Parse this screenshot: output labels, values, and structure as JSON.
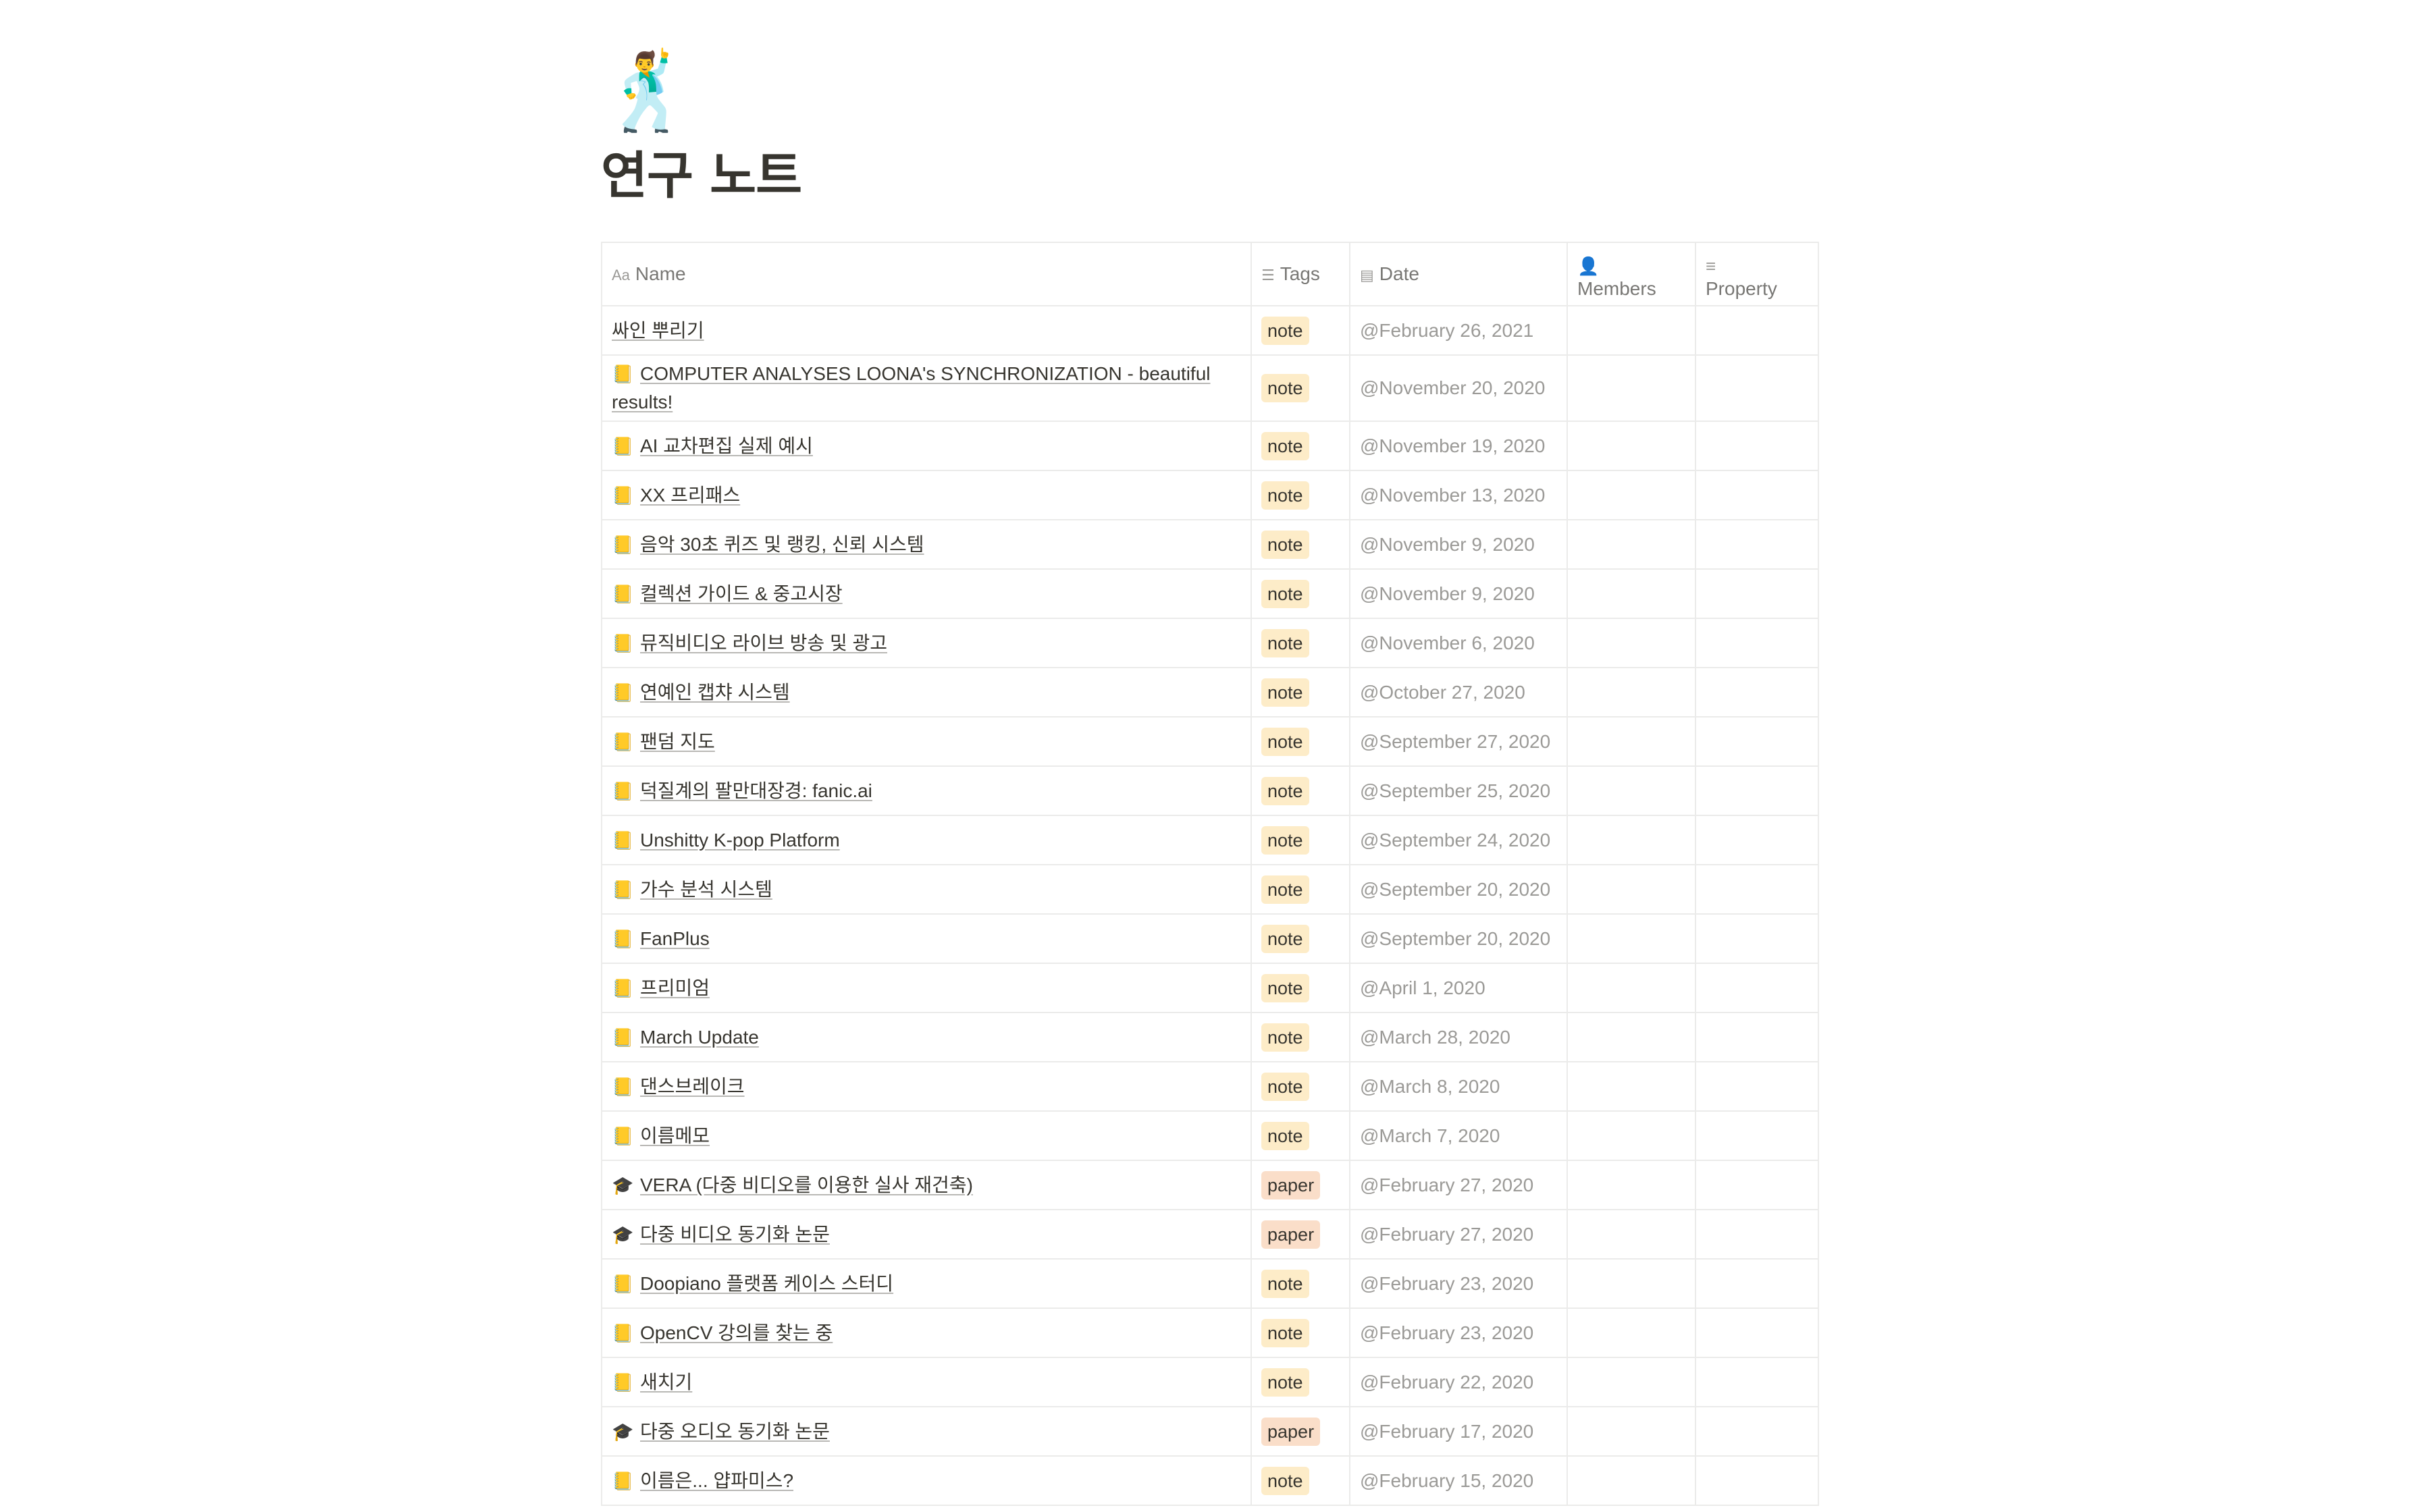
{
  "page": {
    "icon": "🕺",
    "title": "연구 노트"
  },
  "columns": {
    "name": {
      "label": "Name",
      "icon": "Aa"
    },
    "tags": {
      "label": "Tags",
      "icon": "list-icon"
    },
    "date": {
      "label": "Date",
      "icon": "calendar-icon"
    },
    "members": {
      "label": "Members",
      "icon": "person-icon"
    },
    "property": {
      "label": "Property",
      "icon": "text-lines-icon"
    }
  },
  "tag_colors": {
    "note": "#fdecc8",
    "paper": "#fadec9"
  },
  "rows": [
    {
      "icon": "",
      "name": "싸인 뿌리기",
      "tag": "note",
      "date": "@February 26, 2021"
    },
    {
      "icon": "📒",
      "name": "COMPUTER ANALYSES LOONA's SYNCHRONIZATION - beautiful results!",
      "tag": "note",
      "date": "@November 20, 2020"
    },
    {
      "icon": "📒",
      "name": "AI 교차편집 실제 예시",
      "tag": "note",
      "date": "@November 19, 2020"
    },
    {
      "icon": "📒",
      "name": "XX 프리패스",
      "tag": "note",
      "date": "@November 13, 2020"
    },
    {
      "icon": "📒",
      "name": "음악 30초 퀴즈 및 랭킹, 신뢰 시스템",
      "tag": "note",
      "date": "@November 9, 2020"
    },
    {
      "icon": "📒",
      "name": "컬렉션 가이드 & 중고시장",
      "tag": "note",
      "date": "@November 9, 2020"
    },
    {
      "icon": "📒",
      "name": "뮤직비디오 라이브 방송 및 광고",
      "tag": "note",
      "date": "@November 6, 2020"
    },
    {
      "icon": "📒",
      "name": "연예인 캡챠 시스템",
      "tag": "note",
      "date": "@October 27, 2020"
    },
    {
      "icon": "📒",
      "name": "팬덤 지도",
      "tag": "note",
      "date": "@September 27, 2020"
    },
    {
      "icon": "📒",
      "name": "덕질계의 팔만대장경: fanic.ai",
      "tag": "note",
      "date": "@September 25, 2020"
    },
    {
      "icon": "📒",
      "name": "Unshitty K-pop Platform",
      "tag": "note",
      "date": "@September 24, 2020"
    },
    {
      "icon": "📒",
      "name": "가수 분석 시스템",
      "tag": "note",
      "date": "@September 20, 2020"
    },
    {
      "icon": "📒",
      "name": "FanPlus",
      "tag": "note",
      "date": "@September 20, 2020"
    },
    {
      "icon": "📒",
      "name": "프리미엄",
      "tag": "note",
      "date": "@April 1, 2020"
    },
    {
      "icon": "📒",
      "name": "March Update",
      "tag": "note",
      "date": "@March 28, 2020"
    },
    {
      "icon": "📒",
      "name": "댄스브레이크",
      "tag": "note",
      "date": "@March 8, 2020"
    },
    {
      "icon": "📒",
      "name": "이름메모",
      "tag": "note",
      "date": "@March 7, 2020"
    },
    {
      "icon": "🎓",
      "name": "VERA (다중 비디오를 이용한 실사 재건축)",
      "tag": "paper",
      "date": "@February 27, 2020"
    },
    {
      "icon": "🎓",
      "name": "다중 비디오 동기화 논문",
      "tag": "paper",
      "date": "@February 27, 2020"
    },
    {
      "icon": "📒",
      "name": "Doopiano 플랫폼 케이스 스터디",
      "tag": "note",
      "date": "@February 23, 2020"
    },
    {
      "icon": "📒",
      "name": "OpenCV 강의를 찾는 중",
      "tag": "note",
      "date": "@February 23, 2020"
    },
    {
      "icon": "📒",
      "name": "새치기",
      "tag": "note",
      "date": "@February 22, 2020"
    },
    {
      "icon": "🎓",
      "name": "다중 오디오 동기화 논문",
      "tag": "paper",
      "date": "@February 17, 2020"
    },
    {
      "icon": "📒",
      "name": "이름은... 얍파미스?",
      "tag": "note",
      "date": "@February 15, 2020"
    }
  ]
}
